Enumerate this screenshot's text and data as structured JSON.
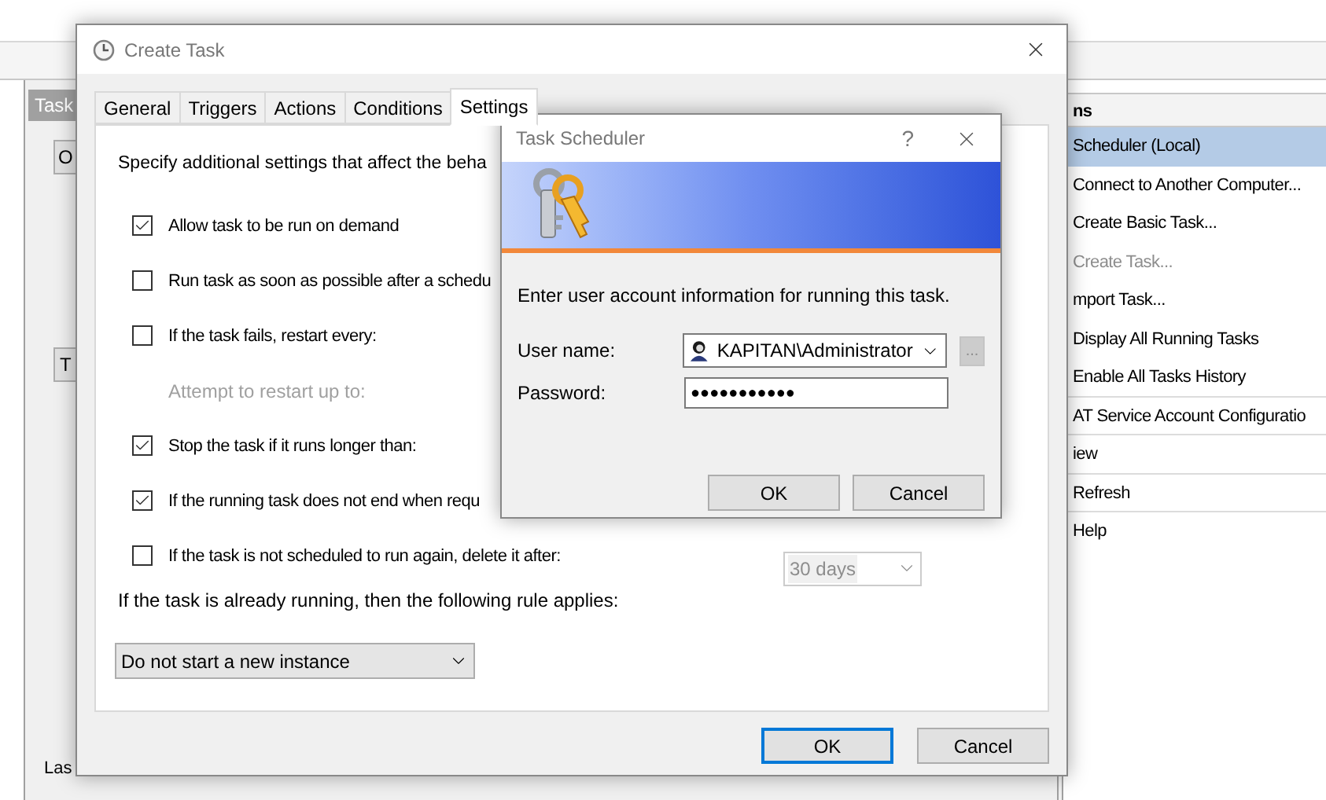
{
  "background_window": {
    "center_header": "Task",
    "overview_button": "O",
    "task_button": "T",
    "status_text": "Las",
    "actions_header": "ns",
    "actions": [
      {
        "label": "Scheduler (Local)",
        "selected": true,
        "disabled": false,
        "separator": false
      },
      {
        "label": "Connect to Another Computer...",
        "selected": false,
        "disabled": false,
        "separator": false
      },
      {
        "label": "Create Basic Task...",
        "selected": false,
        "disabled": false,
        "separator": false
      },
      {
        "label": "Create Task...",
        "selected": false,
        "disabled": true,
        "separator": false
      },
      {
        "label": "mport Task...",
        "selected": false,
        "disabled": false,
        "separator": false
      },
      {
        "label": "Display All Running Tasks",
        "selected": false,
        "disabled": false,
        "separator": false
      },
      {
        "label": "Enable All Tasks History",
        "selected": false,
        "disabled": false,
        "separator": true
      },
      {
        "label": "AT Service Account Configuratio",
        "selected": false,
        "disabled": false,
        "separator": true
      },
      {
        "label": "iew",
        "selected": false,
        "disabled": false,
        "separator": true
      },
      {
        "label": "Refresh",
        "selected": false,
        "disabled": false,
        "separator": true
      },
      {
        "label": "Help",
        "selected": false,
        "disabled": false,
        "separator": false
      }
    ]
  },
  "create_task": {
    "title": "Create Task",
    "tabs": [
      {
        "label": "General",
        "selected": false
      },
      {
        "label": "Triggers",
        "selected": false
      },
      {
        "label": "Actions",
        "selected": false
      },
      {
        "label": "Conditions",
        "selected": false
      },
      {
        "label": "Settings",
        "selected": true
      }
    ],
    "intro": "Specify additional settings that affect the beha",
    "options": [
      {
        "kind": "checkbox",
        "label": "Allow task to be run on demand",
        "checked": true
      },
      {
        "kind": "checkbox",
        "label": "Run task as soon as possible after a schedu",
        "checked": false
      },
      {
        "kind": "checkbox",
        "label": "If the task fails, restart every:",
        "checked": false
      },
      {
        "kind": "note",
        "label": "Attempt to restart up to:",
        "disabled": true
      },
      {
        "kind": "checkbox",
        "label": "Stop the task if it runs longer than:",
        "checked": true
      },
      {
        "kind": "checkbox",
        "label": "If the running task does not end when requ",
        "checked": true
      },
      {
        "kind": "checkbox",
        "label": "If the task is not scheduled to run again, delete it after:",
        "checked": false,
        "duration": {
          "value": "30 days",
          "disabled": true
        }
      }
    ],
    "rule_label": "If the task is already running, then the following rule applies:",
    "rule_dropdown": {
      "value": "Do not start a new instance"
    },
    "buttons": [
      {
        "label": "OK",
        "default": true
      },
      {
        "label": "Cancel",
        "default": false
      }
    ]
  },
  "credentials_dialog": {
    "title": "Task Scheduler",
    "help": "?",
    "prompt": "Enter user account information for running this task.",
    "user_label": "User name:",
    "user_value": "KAPITAN\\Administrator",
    "browse": {
      "label": "...",
      "disabled": true
    },
    "password_label": "Password:",
    "password_value": "●●●●●●●●●●●",
    "buttons": [
      {
        "label": "OK",
        "default": false
      },
      {
        "label": "Cancel",
        "default": false
      }
    ]
  }
}
